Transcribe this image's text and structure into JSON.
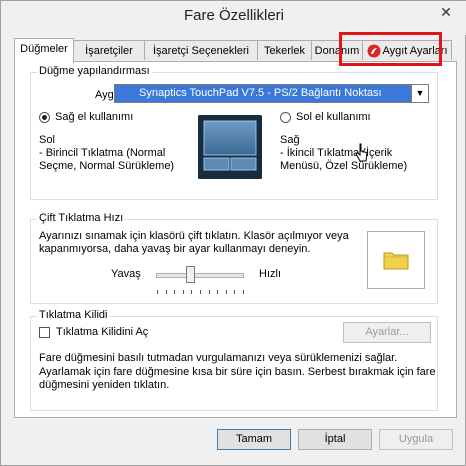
{
  "window": {
    "title": "Fare Özellikleri",
    "close_glyph": "✕"
  },
  "tabs": [
    {
      "label": "Düğmeler",
      "active": true
    },
    {
      "label": "İşaretçiler",
      "active": false
    },
    {
      "label": "İşaretçi Seçenekleri",
      "active": false
    },
    {
      "label": "Tekerlek",
      "active": false
    },
    {
      "label": "Donanım",
      "active": false
    },
    {
      "label": "Aygıt Ayarları",
      "active": false
    }
  ],
  "button_config": {
    "group_label": "Düğme yapılandırması",
    "devices_label": "Aygıtlar:",
    "device_selected": "Synaptics TouchPad V7.5 - PS/2 Bağlantı Noktası",
    "right_hand_label": "Sağ el kullanımı",
    "left_hand_label": "Sol el kullanımı",
    "right_hand_selected": true,
    "left_title": "Sol",
    "left_desc1": " - Birincil Tıklatma (Normal",
    "left_desc2": "Seçme, Normal Sürükleme)",
    "right_title": "Sağ",
    "right_desc1": " - İkincil Tıklatma (İçerik",
    "right_desc2": "Menüsü, Özel Sürükleme)"
  },
  "double_click": {
    "group_label": "Çift Tıklatma Hızı",
    "desc1": "Ayarınızı sınamak için klasörü çift tıklatın.  Klasör açılmıyor veya",
    "desc2": "kapanmıyorsa, daha yavaş bir ayar kullanmayı deneyin.",
    "slow_label": "Yavaş",
    "fast_label": "Hızlı",
    "speed_fraction": 0.4
  },
  "click_lock": {
    "group_label": "Tıklatma Kilidi",
    "checkbox_label": "Tıklatma Kilidini Aç",
    "checked": false,
    "settings_button": "Ayarlar...",
    "desc1": "Fare düğmesini basılı tutmadan vurgulamanızı veya sürüklemenizi sağlar.",
    "desc2": "Ayarlamak için fare düğmesine kısa bir süre için basın.  Serbest bırakmak için fare",
    "desc3": "düğmesini yeniden tıklatın."
  },
  "footer": {
    "ok": "Tamam",
    "cancel": "İptal",
    "apply": "Uygula"
  },
  "colors": {
    "highlight": "#e0161c",
    "select_bg": "#3b78d8"
  },
  "icons": [
    "close-icon",
    "synaptics-icon",
    "chevron-down-icon",
    "touchpad-image",
    "folder-icon",
    "mouse-cursor-icon"
  ]
}
